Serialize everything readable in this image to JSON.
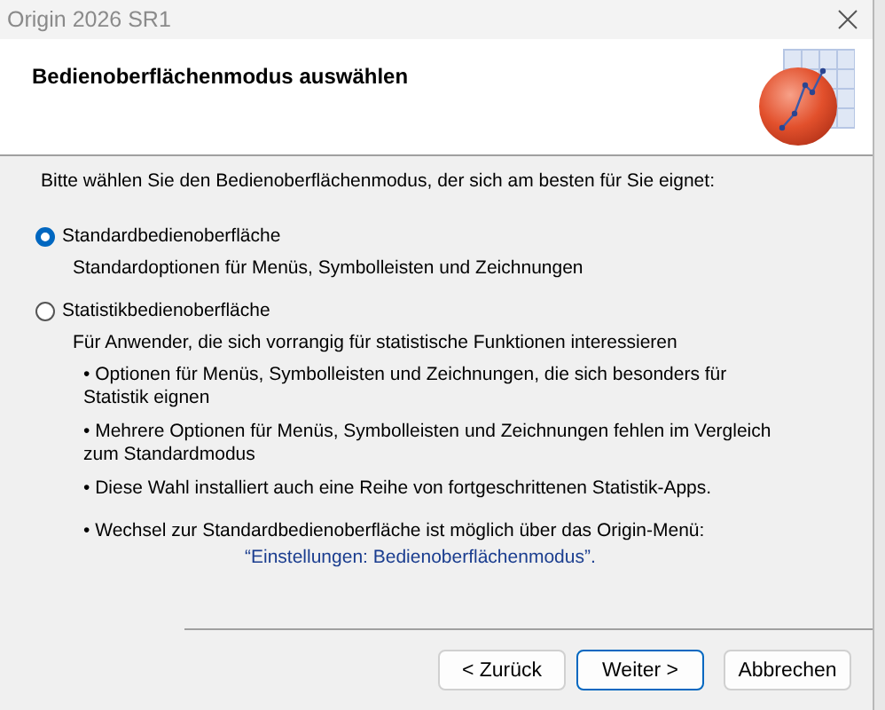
{
  "window": {
    "title": "Origin 2026 SR1"
  },
  "header": {
    "title": "Bedienoberflächenmodus auswählen"
  },
  "intro": "Bitte wählen Sie den Bedienoberflächenmodus, der sich am besten für Sie eignet:",
  "options": [
    {
      "label": "Standardbedienoberfläche",
      "selected": true,
      "description": "Standardoptionen für Menüs, Symbolleisten und Zeichnungen"
    },
    {
      "label": "Statistikbedienoberfläche",
      "selected": false,
      "description": "Für Anwender, die sich vorrangig für statistische Funktionen interessieren",
      "notes": [
        {
          "kind": "bullet",
          "text": "• Optionen für Menüs, Symbolleisten und Zeichnungen, die sich besonders für Statistik eignen"
        },
        {
          "kind": "bullet",
          "text": "• Mehrere Optionen für Menüs, Symbolleisten und Zeichnungen fehlen im Vergleich zum Standardmodus"
        },
        {
          "kind": "bullet",
          "text": "• Diese Wahl installiert auch eine Reihe von fortgeschrittenen Statistik-Apps."
        },
        {
          "kind": "bullet",
          "text": "• Wechsel zur Standardbedienoberfläche ist möglich über das Origin-Menü:"
        },
        {
          "kind": "menu-path",
          "text": "“Einstellungen: Bedienoberflächenmodus”."
        }
      ]
    }
  ],
  "buttons": [
    {
      "label": "< Zurück",
      "default": false
    },
    {
      "label": "Weiter >",
      "default": true
    },
    {
      "label": "Abbrechen",
      "default": false
    }
  ]
}
